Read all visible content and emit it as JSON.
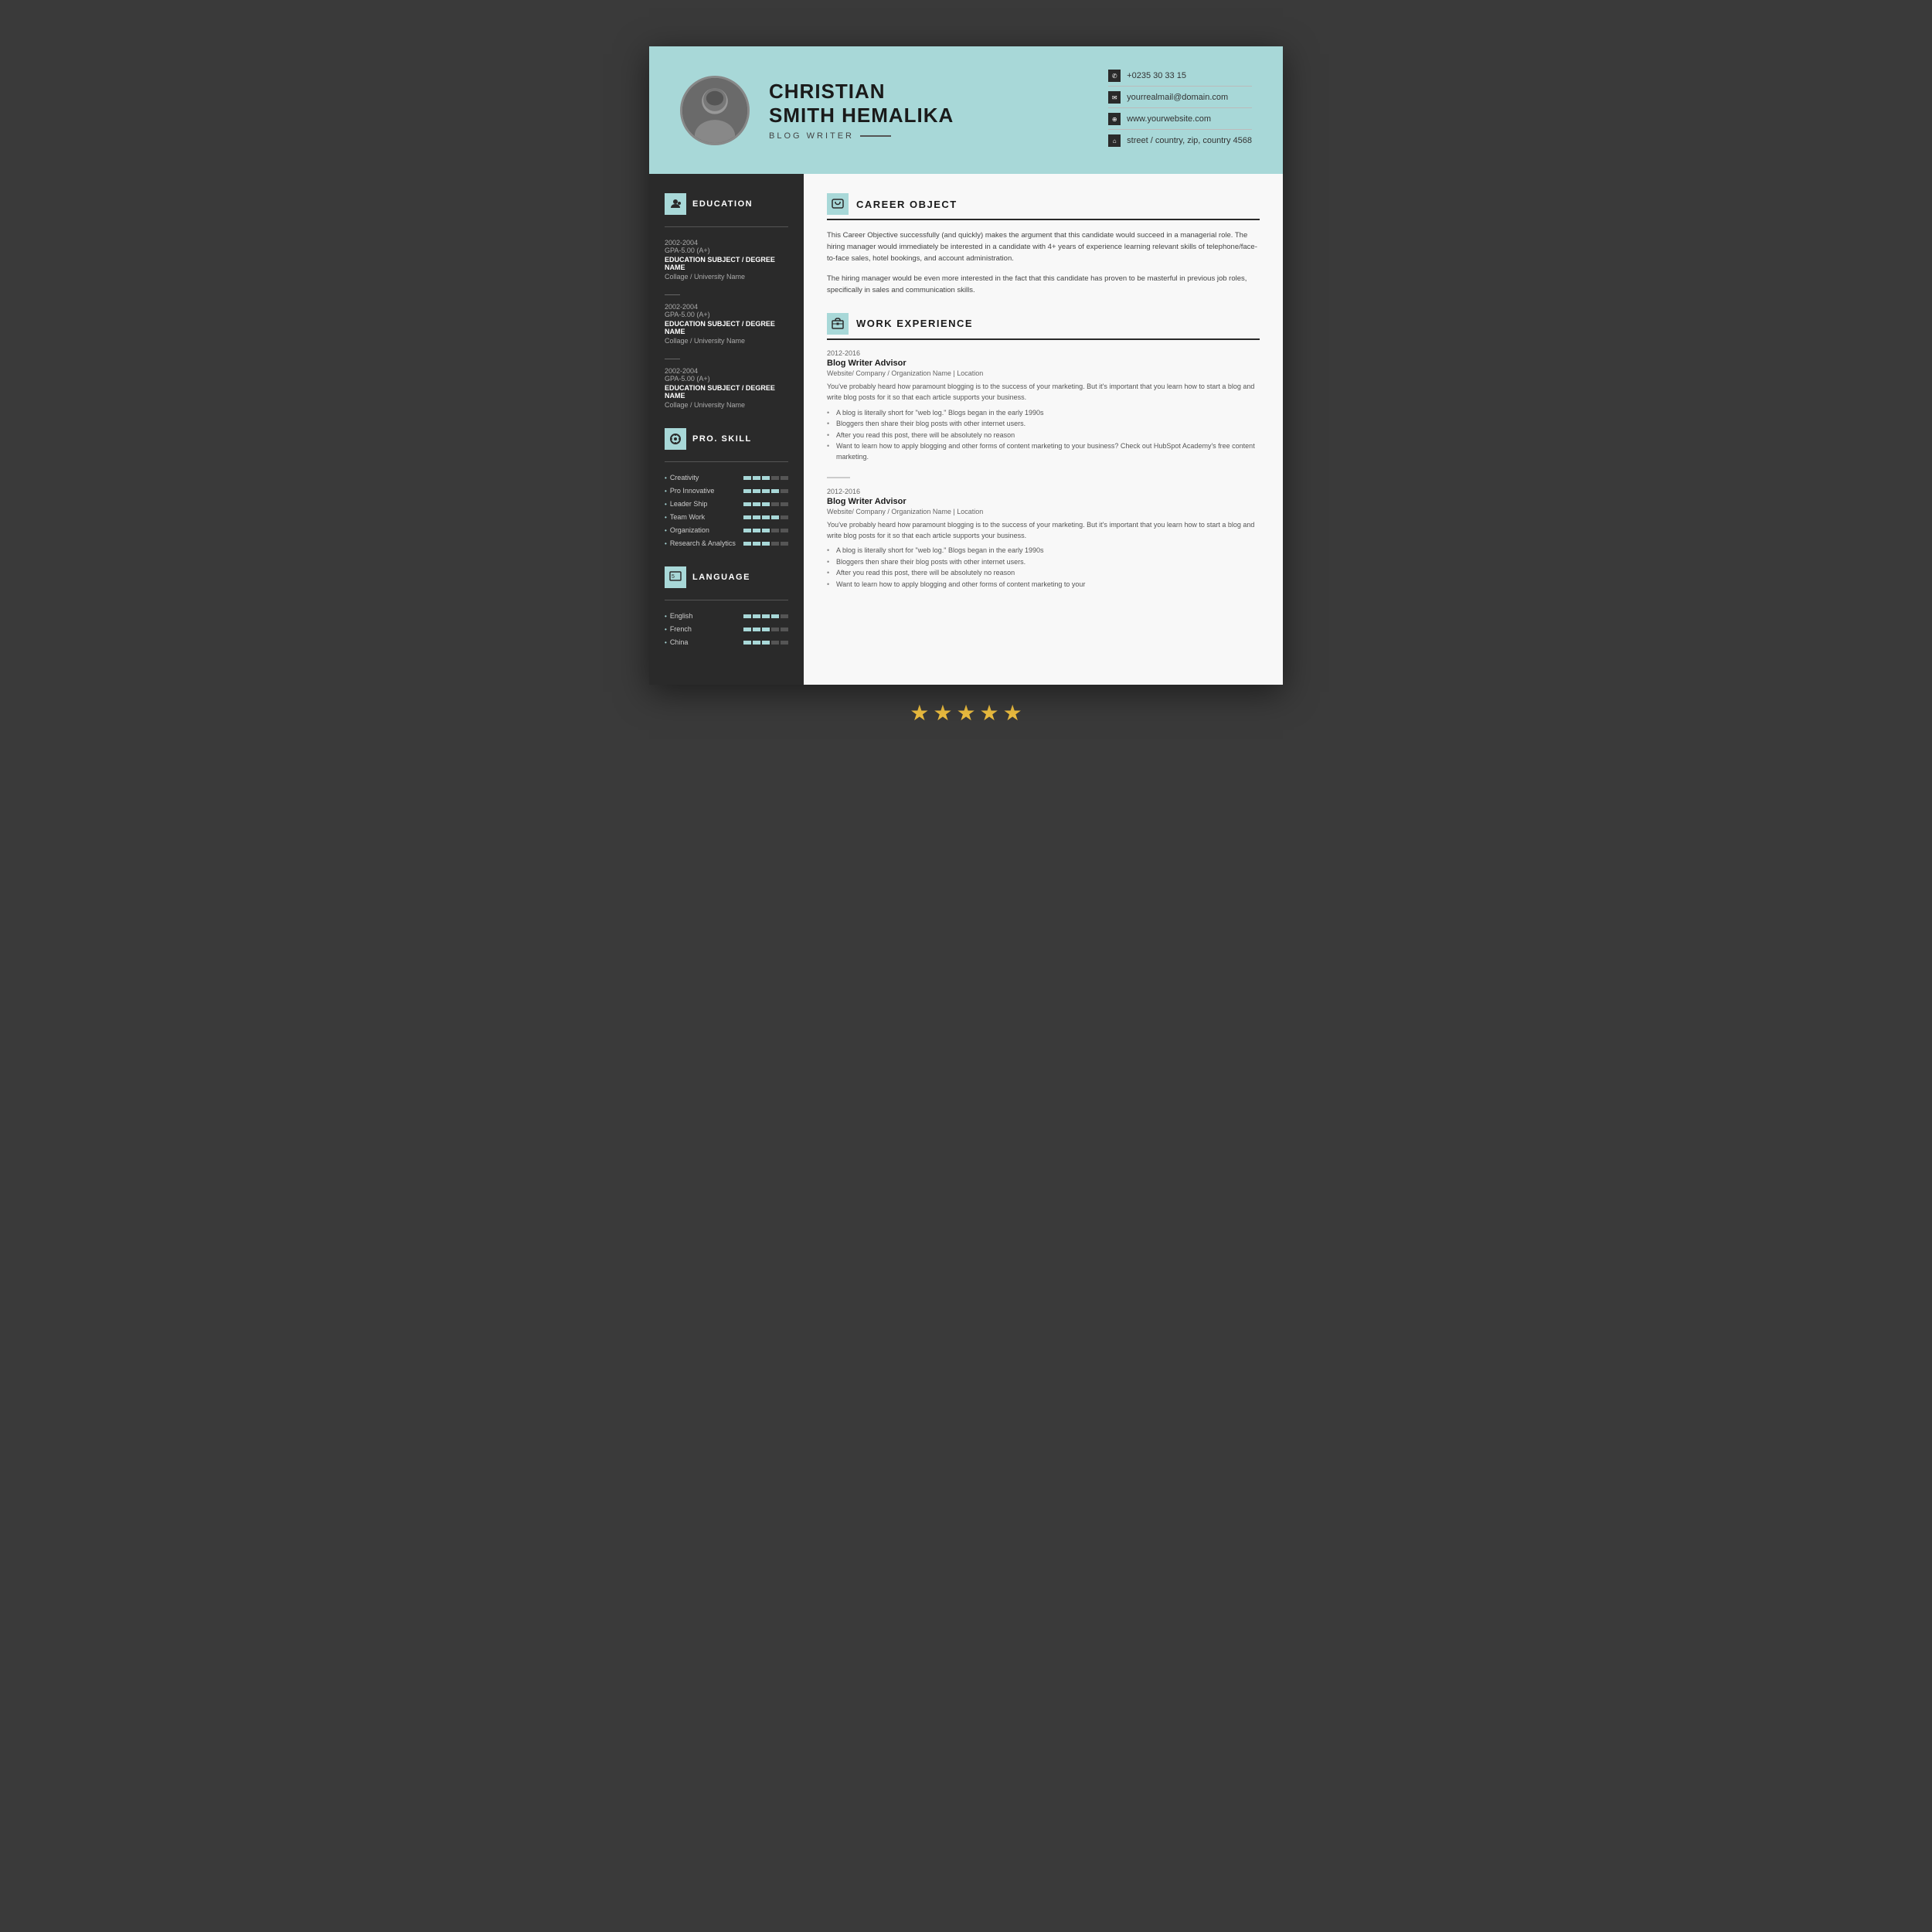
{
  "header": {
    "name_line1": "CHRISTIAN",
    "name_line2": "SMITH HEMALIKA",
    "title": "BLOG WRITER",
    "phone": "+0235 30 33 15",
    "email": "yourrealmail@domain.com",
    "website": "www.yourwebsite.com",
    "address": "street / country, zip, country 4568"
  },
  "sidebar": {
    "education_title": "EDUCATION",
    "education_items": [
      {
        "years": "2002-2004",
        "gpa": "GPA-5.00 (A+)",
        "subject": "EDUCATION SUBJECT / DEGREE NAME",
        "college": "Collage / University Name"
      },
      {
        "years": "2002-2004",
        "gpa": "GPA-5.00 (A+)",
        "subject": "EDUCATION SUBJECT / DEGREE NAME",
        "college": "Collage / University Name"
      },
      {
        "years": "2002-2004",
        "gpa": "GPA-5.00 (A+)",
        "subject": "EDUCATION SUBJECT / DEGREE NAME",
        "college": "Collage / University Name"
      }
    ],
    "skill_title": "PRO. SKILL",
    "skills": [
      {
        "label": "Creativity",
        "filled": 3,
        "total": 5
      },
      {
        "label": "Pro Innovative",
        "filled": 4,
        "total": 5
      },
      {
        "label": "Leader Ship",
        "filled": 3,
        "total": 5
      },
      {
        "label": "Team Work",
        "filled": 4,
        "total": 5
      },
      {
        "label": "Organization",
        "filled": 3,
        "total": 5
      },
      {
        "label": "Research & Analytics",
        "filled": 3,
        "total": 5
      }
    ],
    "language_title": "LANGUAGE",
    "languages": [
      {
        "label": "English",
        "filled": 4,
        "total": 5
      },
      {
        "label": "French",
        "filled": 3,
        "total": 5
      },
      {
        "label": "China",
        "filled": 3,
        "total": 5
      }
    ]
  },
  "main": {
    "career_title": "CAREER OBJECT",
    "career_para1": "This Career Objective successfully (and quickly) makes the argument that this candidate would succeed in a managerial role.  The hiring manager would immediately be interested in a candidate with 4+ years of experience learning relevant skills of telephone/face-to-face sales, hotel bookings, and account administration.",
    "career_para2": "The hiring manager would be even more interested in the fact that this candidate has proven to be masterful in previous job roles, specifically in sales and communication skills.",
    "work_title": "WORK EXPERIENCE",
    "work_items": [
      {
        "years": "2012-2016",
        "title": "Blog Writer Advisor",
        "company": "Website/ Company / Organization Name  |  Location",
        "desc": "You've probably heard how paramount blogging is to the success of your marketing. But it's important that you learn how to start a blog and write blog posts for it so that each article supports your business.",
        "bullets": [
          "A blog is literally short for \"web log.\" Blogs began in the early 1990s",
          "Bloggers then share their blog posts with other internet users.",
          "After you read this post, there will be absolutely no reason",
          "Want to learn how to apply blogging and other forms of content marketing to your business? Check out HubSpot Academy's free content marketing."
        ]
      },
      {
        "years": "2012-2016",
        "title": "Blog Writer Advisor",
        "company": "Website/ Company / Organization Name  |  Location",
        "desc": "You've probably heard how paramount blogging is to the success of your marketing. But it's important that you learn how to start a blog and write blog posts for it so that each article supports your business.",
        "bullets": [
          "A blog is literally short for \"web log.\" Blogs began in the early 1990s",
          "Bloggers then share their blog posts with other internet users.",
          "After you read this post, there will be absolutely no reason",
          "Want to learn how to apply blogging and other forms of content marketing to your"
        ]
      }
    ]
  },
  "stars": {
    "count": 5,
    "label": "★★★★★"
  }
}
